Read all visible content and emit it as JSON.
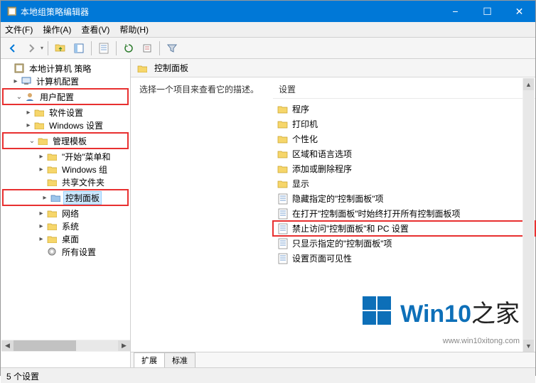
{
  "window": {
    "title": "本地组策略编辑器"
  },
  "menus": {
    "file": "文件(F)",
    "action": "操作(A)",
    "view": "查看(V)",
    "help": "帮助(H)"
  },
  "tree": {
    "root": "本地计算机 策略",
    "computer_cfg": "计算机配置",
    "user_cfg": "用户配置",
    "software": "软件设置",
    "windows_settings": "Windows 设置",
    "admin_templates": "管理模板",
    "start_menu": "\"开始\"菜单和",
    "windows_comp": "Windows 组",
    "shared_folders": "共享文件夹",
    "control_panel": "控制面板",
    "network": "网络",
    "system": "系统",
    "desktop": "桌面",
    "all_settings": "所有设置"
  },
  "content": {
    "header": "控制面板",
    "desc": "选择一个项目来查看它的描述。",
    "col_setting": "设置",
    "items": [
      {
        "t": "folder",
        "label": "程序"
      },
      {
        "t": "folder",
        "label": "打印机"
      },
      {
        "t": "folder",
        "label": "个性化"
      },
      {
        "t": "folder",
        "label": "区域和语言选项"
      },
      {
        "t": "folder",
        "label": "添加或删除程序"
      },
      {
        "t": "folder",
        "label": "显示"
      },
      {
        "t": "setting",
        "label": "隐藏指定的\"控制面板\"项"
      },
      {
        "t": "setting",
        "label": "在打开\"控制面板\"时始终打开所有控制面板项"
      },
      {
        "t": "setting",
        "label": "禁止访问\"控制面板\"和 PC 设置",
        "hl": true
      },
      {
        "t": "setting",
        "label": "只显示指定的\"控制面板\"项"
      },
      {
        "t": "setting",
        "label": "设置页面可见性"
      }
    ]
  },
  "tabs": {
    "extended": "扩展",
    "standard": "标准"
  },
  "status": "5 个设置",
  "watermark": {
    "brand_a": "Win10",
    "brand_b": "之家",
    "url": "www.win10xitong.com"
  }
}
